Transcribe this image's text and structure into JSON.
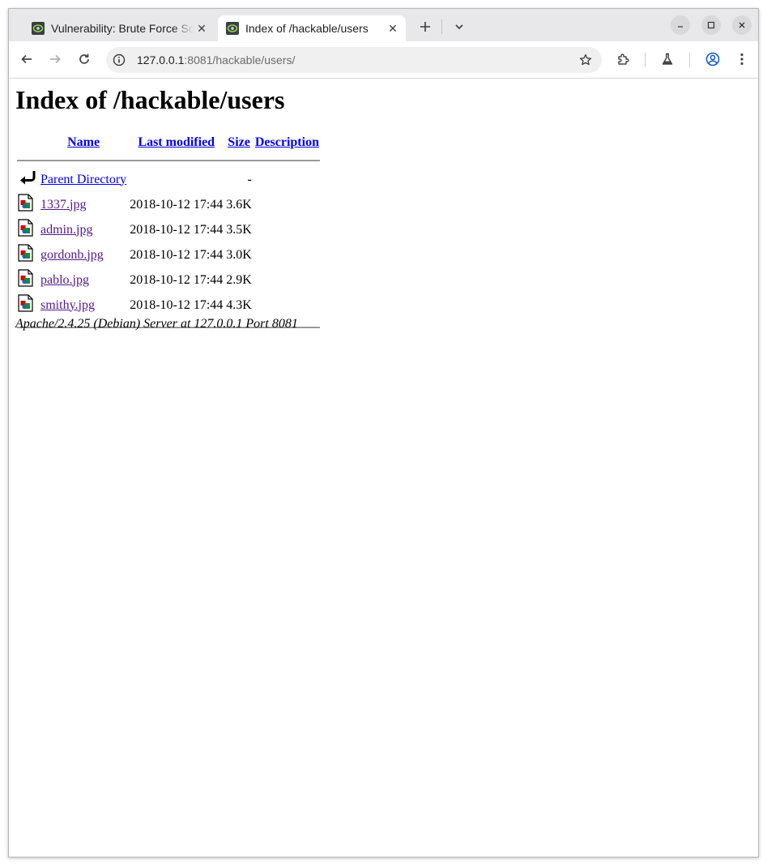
{
  "browser": {
    "tabs": [
      {
        "title": "Vulnerability: Brute Force Source",
        "active": false,
        "close": "✕"
      },
      {
        "title": "Index of /hackable/users",
        "active": true,
        "close": "✕"
      }
    ],
    "new_tab_icon": "plus-icon",
    "tab_search_icon": "chevron-down-icon",
    "window_controls": [
      "minimize-icon",
      "maximize-icon",
      "close-icon"
    ],
    "nav_icons": [
      "back-arrow-icon",
      "forward-arrow-icon",
      "reload-icon"
    ],
    "address_bar": {
      "host": "127.0.0.1",
      "path": ":8081/hackable/users/"
    },
    "toolbar_icons": [
      "extensions-icon",
      "labs-flask-icon",
      "profile-icon",
      "kebab-menu-icon"
    ],
    "accent": "#0b57d0"
  },
  "page": {
    "title": "Index of /hackable/users",
    "columns": {
      "name": "Name",
      "last_modified": "Last modified",
      "size": "Size",
      "description": "Description"
    },
    "parent": {
      "name": "Parent Directory",
      "size": "-"
    },
    "files": [
      {
        "name": "1337.jpg",
        "modified": "2018-10-12 17:44",
        "size": "3.6K"
      },
      {
        "name": "admin.jpg",
        "modified": "2018-10-12 17:44",
        "size": "3.5K"
      },
      {
        "name": "gordonb.jpg",
        "modified": "2018-10-12 17:44",
        "size": "3.0K"
      },
      {
        "name": "pablo.jpg",
        "modified": "2018-10-12 17:44",
        "size": "2.9K"
      },
      {
        "name": "smithy.jpg",
        "modified": "2018-10-12 17:44",
        "size": "4.3K"
      }
    ],
    "footer": "Apache/2.4.25 (Debian) Server at 127.0.0.1 Port 8081"
  }
}
